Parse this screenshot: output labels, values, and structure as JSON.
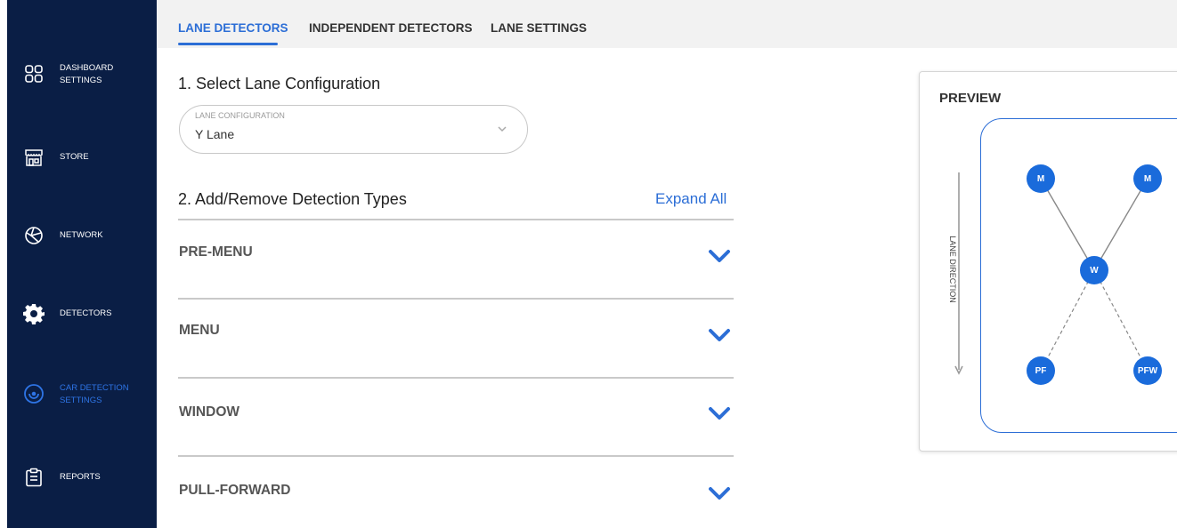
{
  "sidebar": {
    "items": [
      {
        "label_line1": "DASHBOARD",
        "label_line2": "SETTINGS",
        "icon": "dashboard-grid-icon"
      },
      {
        "label_line1": "STORE",
        "label_line2": "",
        "icon": "store-icon"
      },
      {
        "label_line1": "NETWORK",
        "label_line2": "",
        "icon": "network-icon"
      },
      {
        "label_line1": "DETECTORS",
        "label_line2": "",
        "icon": "gear-icon"
      },
      {
        "label_line1": "CAR DETECTION",
        "label_line2": "SETTINGS",
        "icon": "car-detection-icon",
        "active": true
      },
      {
        "label_line1": "REPORTS",
        "label_line2": "",
        "icon": "clipboard-icon"
      }
    ]
  },
  "tabs": [
    {
      "label": "LANE DETECTORS",
      "active": true
    },
    {
      "label": "INDEPENDENT DETECTORS",
      "active": false
    },
    {
      "label": "LANE SETTINGS",
      "active": false
    }
  ],
  "step1": {
    "title": "1. Select Lane Configuration",
    "select_label": "LANE CONFIGURATION",
    "select_value": "Y Lane"
  },
  "step2": {
    "title": "2. Add/Remove Detection Types",
    "expand_all": "Expand All",
    "sections": [
      "PRE-MENU",
      "MENU",
      "WINDOW",
      "PULL-FORWARD"
    ]
  },
  "preview": {
    "title": "PREVIEW",
    "lane_direction": "LANE DIRECTION",
    "nodes": [
      "M",
      "M",
      "W",
      "PF",
      "PFW"
    ]
  },
  "colors": {
    "sidebar_bg": "#0a1e45",
    "accent": "#2c6ed6",
    "node": "#1a6bdb",
    "topbar_bg": "#f2f2f2"
  }
}
